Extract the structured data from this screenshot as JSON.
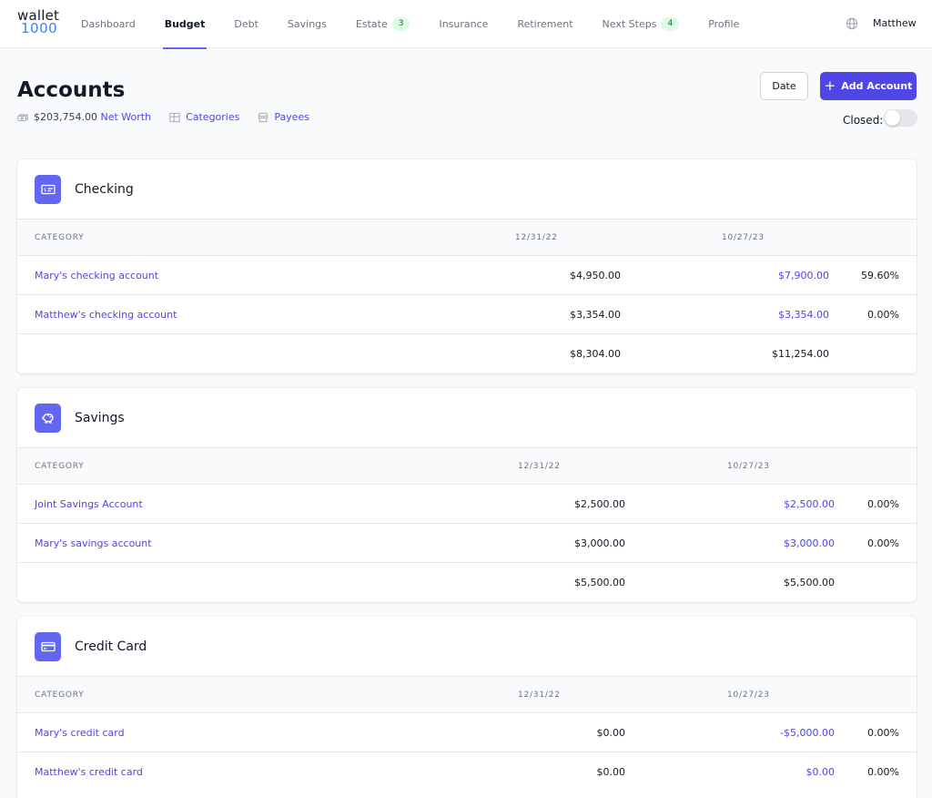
{
  "logo": {
    "line1": "wallet",
    "line2": "1000"
  },
  "nav": {
    "items": [
      {
        "label": "Dashboard",
        "badge": ""
      },
      {
        "label": "Budget",
        "badge": ""
      },
      {
        "label": "Debt",
        "badge": ""
      },
      {
        "label": "Savings",
        "badge": ""
      },
      {
        "label": "Estate",
        "badge": "3"
      },
      {
        "label": "Insurance",
        "badge": ""
      },
      {
        "label": "Retirement",
        "badge": ""
      },
      {
        "label": "Next Steps",
        "badge": "4"
      },
      {
        "label": "Profile",
        "badge": ""
      }
    ],
    "active": "Budget",
    "user": "Matthew"
  },
  "header": {
    "title": "Accounts",
    "net_worth_value": "$203,754.00",
    "net_worth_label": "Net Worth",
    "categories_label": "Categories",
    "payees_label": "Payees",
    "date_button": "Date",
    "add_button": "Add Account",
    "closed_label": "Closed:",
    "closed_toggle_on": false
  },
  "columns": {
    "category": "CATEGORY",
    "date1": "12/31/22",
    "date2": "10/27/23"
  },
  "sections": [
    {
      "title": "Checking",
      "icon": "check-icon",
      "rows": [
        {
          "name": "Mary's checking account",
          "v1": "$4,950.00",
          "v2": "$7,900.00",
          "pct": "59.60%"
        },
        {
          "name": "Matthew's checking account",
          "v1": "$3,354.00",
          "v2": "$3,354.00",
          "pct": "0.00%"
        }
      ],
      "total": {
        "v1": "$8,304.00",
        "v2": "$11,254.00"
      }
    },
    {
      "title": "Savings",
      "icon": "piggy-bank-icon",
      "rows": [
        {
          "name": "Joint Savings Account",
          "v1": "$2,500.00",
          "v2": "$2,500.00",
          "pct": "0.00%"
        },
        {
          "name": "Mary's savings account",
          "v1": "$3,000.00",
          "v2": "$3,000.00",
          "pct": "0.00%"
        }
      ],
      "total": {
        "v1": "$5,500.00",
        "v2": "$5,500.00"
      }
    },
    {
      "title": "Credit Card",
      "icon": "credit-card-icon",
      "rows": [
        {
          "name": "Mary's credit card",
          "v1": "$0.00",
          "v2": "-$5,000.00",
          "pct": "0.00%"
        },
        {
          "name": "Matthew's credit card",
          "v1": "$0.00",
          "v2": "$0.00",
          "pct": "0.00%"
        }
      ]
    }
  ],
  "colors": {
    "accent": "#4f46e5",
    "icon_bg": "#6366f1",
    "badge_bg": "#dcfce7",
    "logo_blue": "#3b82f6"
  }
}
